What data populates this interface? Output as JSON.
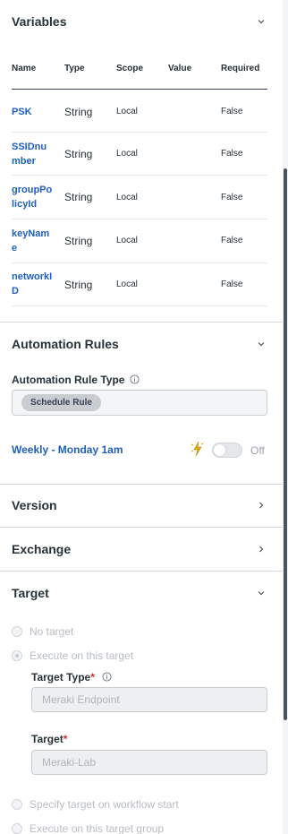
{
  "variables": {
    "title": "Variables",
    "columns": [
      "Name",
      "Type",
      "Scope",
      "Value",
      "Required"
    ],
    "rows": [
      {
        "name_line1": "PSK",
        "name_line2": "",
        "type": "String",
        "scope": "Local",
        "value": "",
        "required": "False"
      },
      {
        "name_line1": "SSIDnu",
        "name_line2": "mber",
        "type": "String",
        "scope": "Local",
        "value": "",
        "required": "False"
      },
      {
        "name_line1": "groupPo",
        "name_line2": "licyId",
        "type": "String",
        "scope": "Local",
        "value": "",
        "required": "False"
      },
      {
        "name_line1": "keyNam",
        "name_line2": "e",
        "type": "String",
        "scope": "Local",
        "value": "",
        "required": "False"
      },
      {
        "name_line1": "networkI",
        "name_line2": "D",
        "type": "String",
        "scope": "Local",
        "value": "",
        "required": "False"
      }
    ]
  },
  "automation_rules": {
    "title": "Automation Rules",
    "rule_type_label": "Automation Rule Type",
    "rule_type_tag": "Schedule Rule",
    "rule_name": "Weekly - Monday 1am",
    "toggle_state": "Off"
  },
  "version": {
    "title": "Version"
  },
  "exchange": {
    "title": "Exchange"
  },
  "target": {
    "title": "Target",
    "options": {
      "no_target": "No target",
      "execute_on_target": "Execute on this target",
      "specify_on_start": "Specify target on workflow start",
      "execute_on_group": "Execute on this target group"
    },
    "target_type_label": "Target Type",
    "target_type_value": "Meraki Endpoint",
    "target_label": "Target",
    "target_value": "Meraki-Lab",
    "required_mark": "*"
  },
  "colors": {
    "link": "#1e5fbf",
    "required": "#d32f2f",
    "heading": "#263238"
  }
}
